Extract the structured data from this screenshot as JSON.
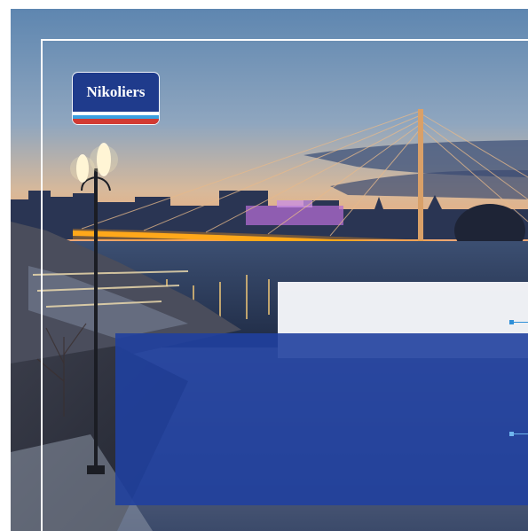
{
  "brand": {
    "logo_text": "Nikoliers",
    "logo_color": "#1f3b8c",
    "stripe_colors": [
      "#ffffff",
      "#3aa0e0",
      "#d23a32"
    ]
  },
  "colors": {
    "panel_blue": "#20409e",
    "panel_white": "#f6f7fa",
    "accent": "#2f8fd8"
  }
}
